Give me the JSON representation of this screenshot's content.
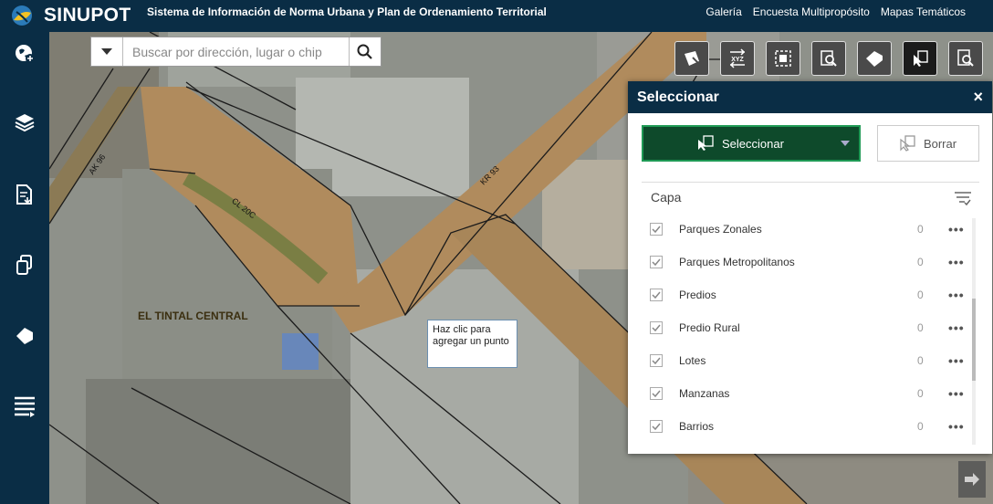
{
  "header": {
    "app_title": "SINUPOT",
    "subtitle": "Sistema de Información de Norma Urbana y Plan de Ordenamiento Territorial",
    "links": [
      "Galería",
      "Encuesta Multipropósito",
      "Mapas Temáticos"
    ]
  },
  "sidebar": {
    "items": [
      "globe-add-icon",
      "layers-icon",
      "document-download-icon",
      "copy-icon",
      "tag-icon",
      "list-icon"
    ]
  },
  "search": {
    "placeholder": "Buscar por dirección, lugar o chip"
  },
  "toolbar": {
    "tools": [
      "select-polygon-icon",
      "xyz-coordinates-icon",
      "extent-icon",
      "map-search-icon",
      "eraser-icon",
      "select-cursor-icon",
      "query-icon"
    ],
    "xyz_label": "XYZ"
  },
  "map": {
    "place_label": "EL TINTAL CENTRAL",
    "street_labels": [
      "AK 96",
      "CL 20C",
      "KR 93"
    ],
    "tooltip": "Haz clic para agregar un punto"
  },
  "panel": {
    "title": "Seleccionar",
    "close": "×",
    "select_button": "Seleccionar",
    "clear_button": "Borrar",
    "capa_label": "Capa",
    "layers": [
      {
        "name": "Parques Zonales",
        "count": "0"
      },
      {
        "name": "Parques Metropolitanos",
        "count": "0"
      },
      {
        "name": "Predios",
        "count": "0"
      },
      {
        "name": "Predio Rural",
        "count": "0"
      },
      {
        "name": "Lotes",
        "count": "0"
      },
      {
        "name": "Manzanas",
        "count": "0"
      },
      {
        "name": "Barrios",
        "count": "0"
      }
    ],
    "more": "•••"
  },
  "colors": {
    "header_bg": "#0a2d45",
    "select_btn_bg": "#0e4a2b",
    "select_btn_border": "#1f9a55",
    "road": "#b38a58"
  }
}
